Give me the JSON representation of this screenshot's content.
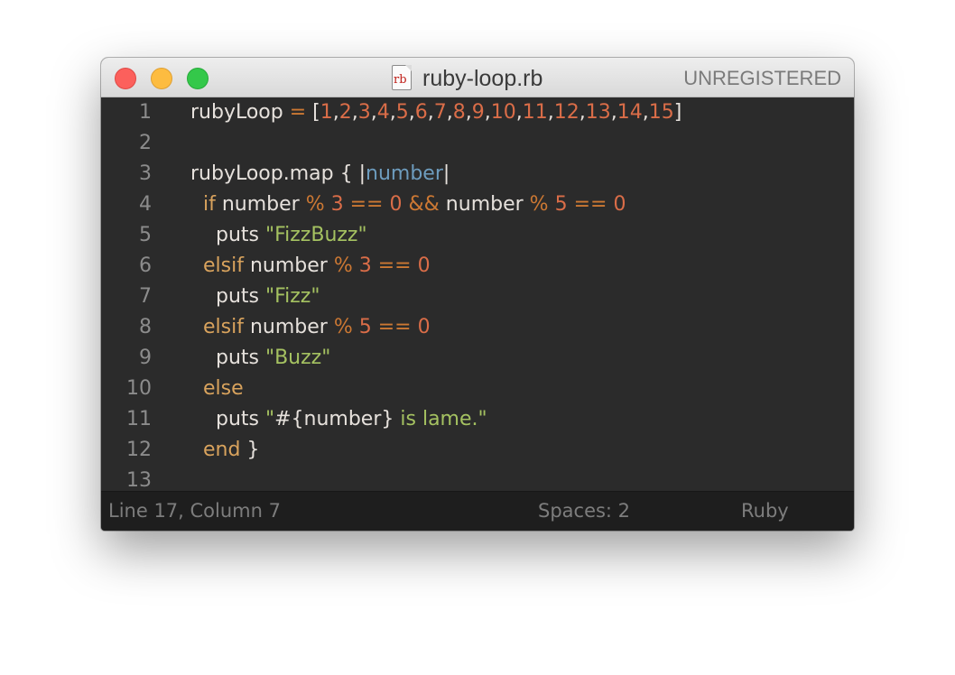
{
  "window": {
    "title": "ruby-loop.rb",
    "file_icon_label": "rb",
    "registration": "UNREGISTERED"
  },
  "editor": {
    "lines": [
      {
        "number": "1",
        "tokens": [
          {
            "t": "rubyLoop ",
            "c": "text"
          },
          {
            "t": "=",
            "c": "op"
          },
          {
            "t": " [",
            "c": "text"
          },
          {
            "t": "1",
            "c": "num"
          },
          {
            "t": ",",
            "c": "text"
          },
          {
            "t": "2",
            "c": "num"
          },
          {
            "t": ",",
            "c": "text"
          },
          {
            "t": "3",
            "c": "num"
          },
          {
            "t": ",",
            "c": "text"
          },
          {
            "t": "4",
            "c": "num"
          },
          {
            "t": ",",
            "c": "text"
          },
          {
            "t": "5",
            "c": "num"
          },
          {
            "t": ",",
            "c": "text"
          },
          {
            "t": "6",
            "c": "num"
          },
          {
            "t": ",",
            "c": "text"
          },
          {
            "t": "7",
            "c": "num"
          },
          {
            "t": ",",
            "c": "text"
          },
          {
            "t": "8",
            "c": "num"
          },
          {
            "t": ",",
            "c": "text"
          },
          {
            "t": "9",
            "c": "num"
          },
          {
            "t": ",",
            "c": "text"
          },
          {
            "t": "10",
            "c": "num"
          },
          {
            "t": ",",
            "c": "text"
          },
          {
            "t": "11",
            "c": "num"
          },
          {
            "t": ",",
            "c": "text"
          },
          {
            "t": "12",
            "c": "num"
          },
          {
            "t": ",",
            "c": "text"
          },
          {
            "t": "13",
            "c": "num"
          },
          {
            "t": ",",
            "c": "text"
          },
          {
            "t": "14",
            "c": "num"
          },
          {
            "t": ",",
            "c": "text"
          },
          {
            "t": "15",
            "c": "num"
          },
          {
            "t": "]",
            "c": "text"
          }
        ]
      },
      {
        "number": "2",
        "tokens": []
      },
      {
        "number": "3",
        "tokens": [
          {
            "t": "rubyLoop.map { |",
            "c": "text"
          },
          {
            "t": "number",
            "c": "var"
          },
          {
            "t": "|",
            "c": "text"
          }
        ]
      },
      {
        "number": "4",
        "tokens": [
          {
            "t": "  ",
            "c": "text"
          },
          {
            "t": "if",
            "c": "kw"
          },
          {
            "t": " number ",
            "c": "text"
          },
          {
            "t": "%",
            "c": "op"
          },
          {
            "t": " ",
            "c": "text"
          },
          {
            "t": "3",
            "c": "num"
          },
          {
            "t": " ",
            "c": "text"
          },
          {
            "t": "==",
            "c": "op"
          },
          {
            "t": " ",
            "c": "text"
          },
          {
            "t": "0",
            "c": "num"
          },
          {
            "t": " ",
            "c": "text"
          },
          {
            "t": "&&",
            "c": "op"
          },
          {
            "t": " number ",
            "c": "text"
          },
          {
            "t": "%",
            "c": "op"
          },
          {
            "t": " ",
            "c": "text"
          },
          {
            "t": "5",
            "c": "num"
          },
          {
            "t": " ",
            "c": "text"
          },
          {
            "t": "==",
            "c": "op"
          },
          {
            "t": " ",
            "c": "text"
          },
          {
            "t": "0",
            "c": "num"
          }
        ]
      },
      {
        "number": "5",
        "tokens": [
          {
            "t": "    puts ",
            "c": "text"
          },
          {
            "t": "\"FizzBuzz\"",
            "c": "str"
          }
        ]
      },
      {
        "number": "6",
        "tokens": [
          {
            "t": "  ",
            "c": "text"
          },
          {
            "t": "elsif",
            "c": "kw"
          },
          {
            "t": " number ",
            "c": "text"
          },
          {
            "t": "%",
            "c": "op"
          },
          {
            "t": " ",
            "c": "text"
          },
          {
            "t": "3",
            "c": "num"
          },
          {
            "t": " ",
            "c": "text"
          },
          {
            "t": "==",
            "c": "op"
          },
          {
            "t": " ",
            "c": "text"
          },
          {
            "t": "0",
            "c": "num"
          }
        ]
      },
      {
        "number": "7",
        "tokens": [
          {
            "t": "    puts ",
            "c": "text"
          },
          {
            "t": "\"Fizz\"",
            "c": "str"
          }
        ]
      },
      {
        "number": "8",
        "tokens": [
          {
            "t": "  ",
            "c": "text"
          },
          {
            "t": "elsif",
            "c": "kw"
          },
          {
            "t": " number ",
            "c": "text"
          },
          {
            "t": "%",
            "c": "op"
          },
          {
            "t": " ",
            "c": "text"
          },
          {
            "t": "5",
            "c": "num"
          },
          {
            "t": " ",
            "c": "text"
          },
          {
            "t": "==",
            "c": "op"
          },
          {
            "t": " ",
            "c": "text"
          },
          {
            "t": "0",
            "c": "num"
          }
        ]
      },
      {
        "number": "9",
        "tokens": [
          {
            "t": "    puts ",
            "c": "text"
          },
          {
            "t": "\"Buzz\"",
            "c": "str"
          }
        ]
      },
      {
        "number": "10",
        "tokens": [
          {
            "t": "  ",
            "c": "text"
          },
          {
            "t": "else",
            "c": "kw"
          }
        ]
      },
      {
        "number": "11",
        "tokens": [
          {
            "t": "    puts ",
            "c": "text"
          },
          {
            "t": "\"",
            "c": "str"
          },
          {
            "t": "#{number}",
            "c": "interp"
          },
          {
            "t": " is lame.\"",
            "c": "str"
          }
        ]
      },
      {
        "number": "12",
        "tokens": [
          {
            "t": "  ",
            "c": "text"
          },
          {
            "t": "end",
            "c": "kw"
          },
          {
            "t": " }",
            "c": "text"
          }
        ]
      },
      {
        "number": "13",
        "tokens": []
      }
    ]
  },
  "statusbar": {
    "position": "Line 17, Column 7",
    "indentation": "Spaces: 2",
    "syntax": "Ruby"
  },
  "colors": {
    "background": "#2b2b2b",
    "text": "#e6e1dc",
    "number": "#da6d48",
    "operator": "#cc7833",
    "keyword": "#d9a35d",
    "string": "#a5c261",
    "block_variable": "#6d9cbe",
    "line_number": "#8c8c8c"
  }
}
